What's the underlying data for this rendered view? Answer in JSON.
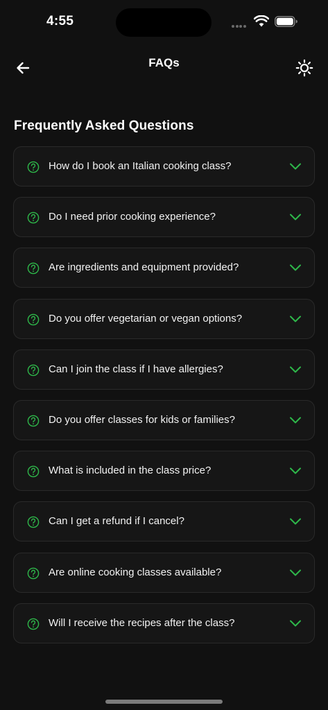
{
  "status_bar": {
    "time": "4:55"
  },
  "header": {
    "title": "FAQs",
    "back_icon": "arrow-left-icon",
    "theme_icon": "sun-icon"
  },
  "section": {
    "title": "Frequently Asked Questions"
  },
  "faqs": [
    {
      "question": "How do I book an Italian cooking class?"
    },
    {
      "question": "Do I need prior cooking experience?"
    },
    {
      "question": "Are ingredients and equipment provided?"
    },
    {
      "question": "Do you offer vegetarian or vegan options?"
    },
    {
      "question": "Can I join the class if I have allergies?"
    },
    {
      "question": "Do you offer classes for kids or families?"
    },
    {
      "question": "What is included in the class price?"
    },
    {
      "question": "Can I get a refund if I cancel?"
    },
    {
      "question": "Are online cooking classes available?"
    },
    {
      "question": "Will I receive the recipes after the class?"
    }
  ],
  "colors": {
    "background": "#111111",
    "card": "#161616",
    "card_border": "#2a2a2a",
    "accent_green": "#2eb84a",
    "text": "#ffffff"
  }
}
